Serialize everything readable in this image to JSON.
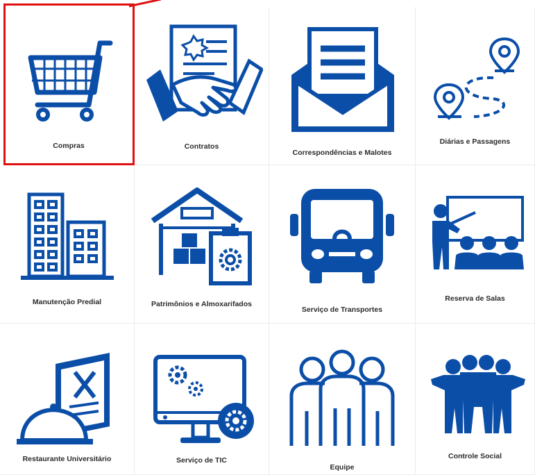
{
  "theme": {
    "icon_color": "#0b4ea8",
    "highlight_color": "#e01010",
    "label_color": "#2b2b2b"
  },
  "tiles": [
    {
      "label": "Compras",
      "icon": "shopping-cart-icon",
      "selected": true
    },
    {
      "label": "Contratos",
      "icon": "handshake-contract-icon"
    },
    {
      "label": "Correspondências e Malotes",
      "icon": "envelope-letter-icon"
    },
    {
      "label": "Diárias e Passagens",
      "icon": "route-pins-icon"
    },
    {
      "label": "Manutenção Predial",
      "icon": "buildings-icon"
    },
    {
      "label": "Patrimônios e Almoxarifados",
      "icon": "warehouse-clipboard-icon"
    },
    {
      "label": "Serviço de Transportes",
      "icon": "bus-icon"
    },
    {
      "label": "Reserva de Salas",
      "icon": "classroom-icon"
    },
    {
      "label": "Restaurante Universitário",
      "icon": "menu-cloche-icon"
    },
    {
      "label": "Serviço de TIC",
      "icon": "monitor-gears-icon"
    },
    {
      "label": "Equipe",
      "icon": "team-outline-icon"
    },
    {
      "label": "Controle Social",
      "icon": "people-group-icon"
    }
  ]
}
